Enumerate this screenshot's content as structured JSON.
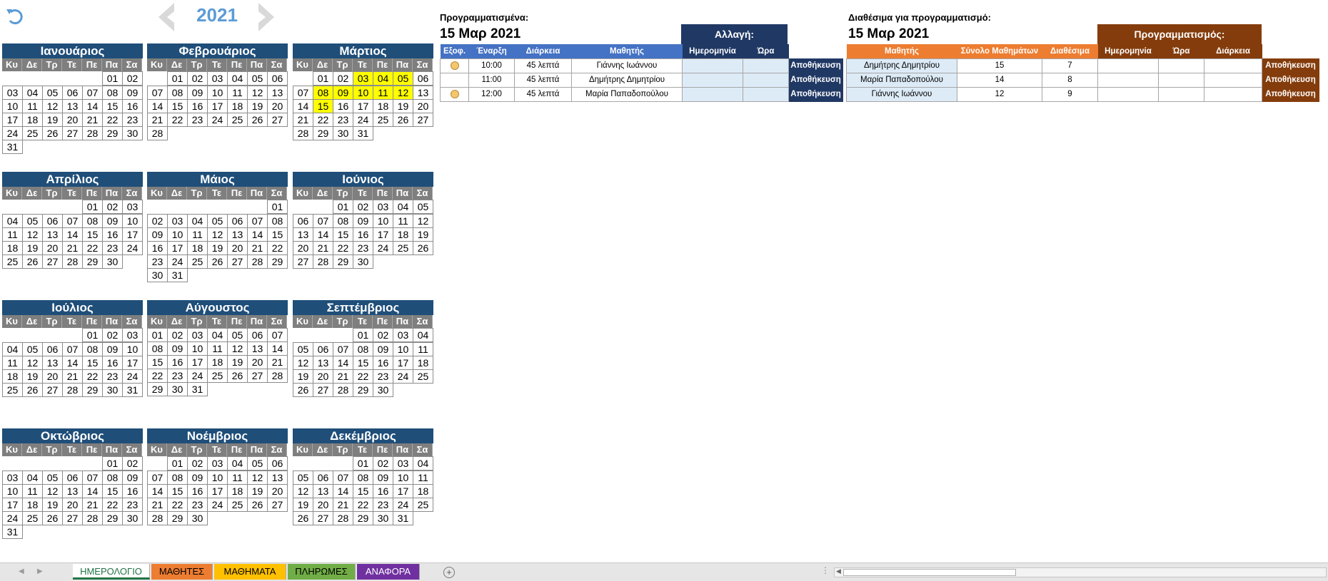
{
  "year": "2021",
  "icons": {
    "undo": "undo-arrow-icon",
    "prev": "chevron-left-icon",
    "next": "chevron-right-icon",
    "paid": "circle-icon",
    "add_sheet": "plus-circle-icon"
  },
  "colors": {
    "month_header": "#1f4e79",
    "highlight": "#ffff00",
    "scheduled_header": "#4472c4",
    "change_header": "#203864",
    "available_header": "#ed7d31",
    "schedule_header": "#843c0c"
  },
  "weekdays": [
    "Κυ",
    "Δε",
    "Τρ",
    "Τε",
    "Πε",
    "Πα",
    "Σα"
  ],
  "months": [
    {
      "name": "Ιανουάριος",
      "offset": 5,
      "days": 31,
      "highlight": []
    },
    {
      "name": "Φεβρουάριος",
      "offset": 1,
      "days": 28,
      "highlight": []
    },
    {
      "name": "Μάρτιος",
      "offset": 1,
      "days": 31,
      "highlight": [
        3,
        4,
        5,
        8,
        9,
        10,
        11,
        12,
        15
      ]
    },
    {
      "name": "Απρίλιος",
      "offset": 4,
      "days": 30,
      "highlight": []
    },
    {
      "name": "Μάιος",
      "offset": 6,
      "days": 31,
      "highlight": []
    },
    {
      "name": "Ιούνιος",
      "offset": 2,
      "days": 30,
      "highlight": []
    },
    {
      "name": "Ιούλιος",
      "offset": 4,
      "days": 31,
      "highlight": []
    },
    {
      "name": "Αύγουστος",
      "offset": 0,
      "days": 31,
      "highlight": []
    },
    {
      "name": "Σεπτέμβριος",
      "offset": 3,
      "days": 30,
      "highlight": []
    },
    {
      "name": "Οκτώβριος",
      "offset": 5,
      "days": 31,
      "highlight": []
    },
    {
      "name": "Νοέμβριος",
      "offset": 1,
      "days": 30,
      "highlight": []
    },
    {
      "name": "Δεκέμβριος",
      "offset": 3,
      "days": 31,
      "highlight": []
    }
  ],
  "scheduled": {
    "title": "Προγραμματισμένα:",
    "date": "15 Μαρ 2021",
    "change_label": "Αλλαγή:",
    "columns": [
      "Εξοφ.",
      "Έναρξη",
      "Διάρκεια",
      "Μαθητής",
      "Ημερομηνία",
      "Ώρα"
    ],
    "rows": [
      {
        "paid": true,
        "start": "10:00",
        "duration": "45 λεπτά",
        "student": "Γιάννης Ιωάννου",
        "date": "",
        "time": "",
        "save": "Αποθήκευση"
      },
      {
        "paid": false,
        "start": "11:00",
        "duration": "45 λεπτά",
        "student": "Δημήτρης Δημητρίου",
        "date": "",
        "time": "",
        "save": "Αποθήκευση"
      },
      {
        "paid": true,
        "start": "12:00",
        "duration": "45 λεπτά",
        "student": "Μαρία Παπαδοπούλου",
        "date": "",
        "time": "",
        "save": "Αποθήκευση"
      }
    ]
  },
  "available": {
    "title": "Διαθέσιμα για προγραμματισμό:",
    "date": "15 Μαρ 2021",
    "schedule_label": "Προγραμματισμός:",
    "columns": [
      "Μαθητής",
      "Σύνολο Μαθημάτων",
      "Διαθέσιμα",
      "Ημερομηνία",
      "Ώρα",
      "Διάρκεια"
    ],
    "rows": [
      {
        "student": "Δημήτρης Δημητρίου",
        "total": "15",
        "available": "7",
        "date": "",
        "time": "",
        "duration": "",
        "save": "Αποθήκευση"
      },
      {
        "student": "Μαρία Παπαδοπούλου",
        "total": "14",
        "available": "8",
        "date": "",
        "time": "",
        "duration": "",
        "save": "Αποθήκευση"
      },
      {
        "student": "Γιάννης Ιωάννου",
        "total": "12",
        "available": "9",
        "date": "",
        "time": "",
        "duration": "",
        "save": "Αποθήκευση"
      }
    ]
  },
  "tabs": [
    {
      "label": "ΗΜΕΡΟΛΟΓΙΟ",
      "color": "#ffffff",
      "active": true
    },
    {
      "label": "ΜΑΘΗΤΕΣ",
      "color": "#ed7d31",
      "active": false
    },
    {
      "label": "ΜΑΘΗΜΑΤΑ",
      "color": "#ffc000",
      "active": false
    },
    {
      "label": "ΠΛΗΡΩΜΕΣ",
      "color": "#70ad47",
      "active": false
    },
    {
      "label": "ΑΝΑΦΟΡΑ",
      "color": "#7030a0",
      "active": false
    }
  ]
}
